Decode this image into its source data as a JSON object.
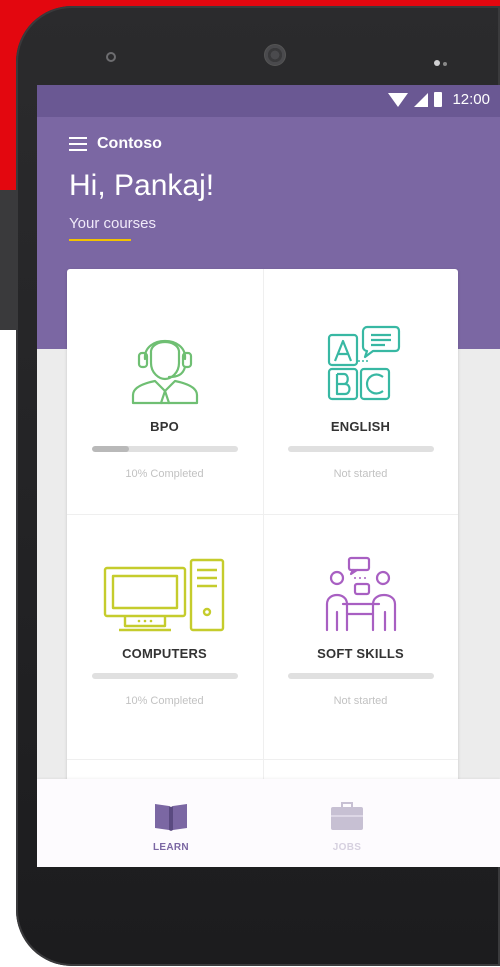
{
  "status_bar": {
    "time": "12:00"
  },
  "header": {
    "app_name": "Contoso",
    "greeting": "Hi, Pankaj!",
    "subtitle": "Your courses"
  },
  "courses": [
    {
      "title": "BPO",
      "status": "10% Completed",
      "progress": 0.1,
      "icon": "call-center-agent-icon",
      "color": "#6fbf73"
    },
    {
      "title": "ENGLISH",
      "status": "Not started",
      "progress": 0,
      "icon": "abc-blocks-icon",
      "color": "#38b8a3"
    },
    {
      "title": "COMPUTERS",
      "status": "10% Completed",
      "progress": 0.1,
      "icon": "desktop-computer-icon",
      "color": "#c5cc2c"
    },
    {
      "title": "SOFT SKILLS",
      "status": "Not started",
      "progress": 0,
      "icon": "people-discussion-icon",
      "color": "#a85fc2"
    }
  ],
  "bottom_nav": [
    {
      "label": "LEARN",
      "icon": "open-book-icon",
      "active": true,
      "color": "#7b67a3"
    },
    {
      "label": "JOBS",
      "icon": "briefcase-icon",
      "active": false,
      "color": "#c7c0d3"
    }
  ],
  "colors": {
    "header": "#7b67a3",
    "status_bar": "#6a5893",
    "accent_underline": "#f2c200",
    "background_red": "#e3070f"
  }
}
